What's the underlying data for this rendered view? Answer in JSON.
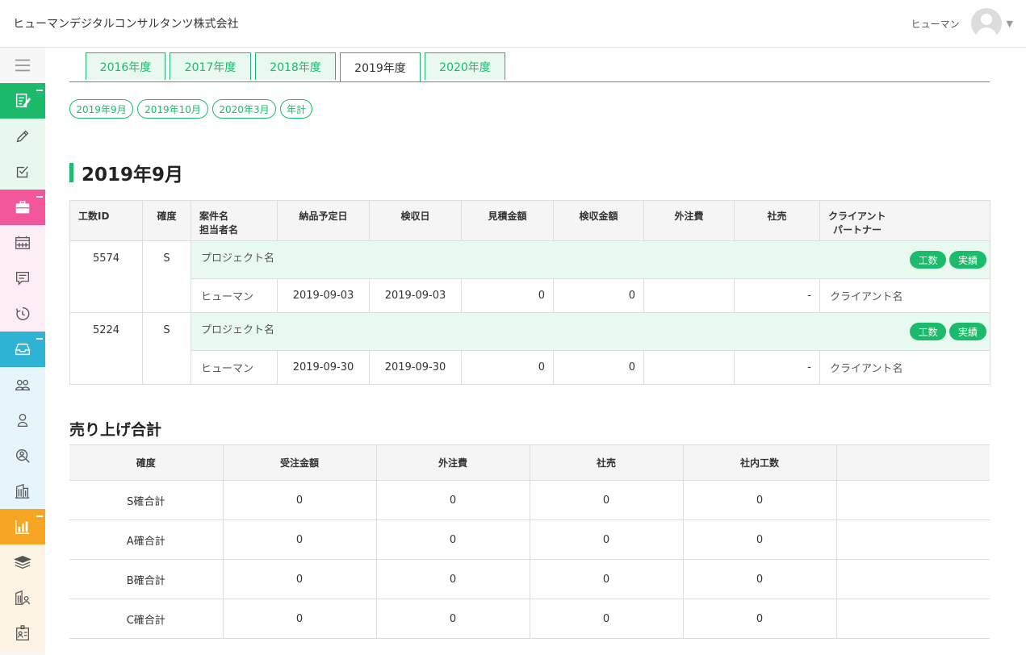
{
  "header": {
    "company": "ヒューマンデジタルコンサルタンツ株式会社",
    "user_name": "ヒューマン"
  },
  "sidebar": {
    "items": [
      {
        "icon": "hamburger-icon"
      },
      {
        "icon": "edit-note-icon"
      },
      {
        "icon": "pencil-icon"
      },
      {
        "icon": "checkbox-icon"
      },
      {
        "icon": "briefcase-icon"
      },
      {
        "icon": "calendar-icon"
      },
      {
        "icon": "chat-icon"
      },
      {
        "icon": "timer-icon"
      },
      {
        "icon": "inbox-icon"
      },
      {
        "icon": "group-icon"
      },
      {
        "icon": "person-icon"
      },
      {
        "icon": "user-search-icon"
      },
      {
        "icon": "building-icon"
      },
      {
        "icon": "bar-chart-icon"
      },
      {
        "icon": "layers-icon"
      },
      {
        "icon": "building-user-icon"
      },
      {
        "icon": "id-card-icon"
      }
    ]
  },
  "tabs": [
    "2016年度",
    "2017年度",
    "2018年度",
    "2019年度",
    "2020年度"
  ],
  "active_tab": "2019年度",
  "months": [
    "2019年9月",
    "2019年10月",
    "2020年3月",
    "年計"
  ],
  "section_title": "2019年9月",
  "table": {
    "headers": {
      "id": "工数ID",
      "certainty": "確度",
      "project_line1": "案件名",
      "project_line2": "担当者名",
      "delivery": "納品予定日",
      "inspection": "検収日",
      "estimate": "見積金額",
      "inspected_amount": "検収金額",
      "outsourcing": "外注費",
      "internal": "社売",
      "client_line1": "クライアント",
      "client_line2": "パートナー"
    },
    "rows": [
      {
        "id": "5574",
        "certainty": "S",
        "project": "プロジェクト名",
        "badge1": "工数",
        "badge2": "実績",
        "person": "ヒューマン",
        "delivery": "2019-09-03",
        "inspection": "2019-09-03",
        "estimate": "0",
        "inspected_amount": "0",
        "outsourcing": "",
        "internal": "-",
        "client": "クライアント名"
      },
      {
        "id": "5224",
        "certainty": "S",
        "project": "プロジェクト名",
        "badge1": "工数",
        "badge2": "実績",
        "person": "ヒューマン",
        "delivery": "2019-09-30",
        "inspection": "2019-09-30",
        "estimate": "0",
        "inspected_amount": "0",
        "outsourcing": "",
        "internal": "-",
        "client": "クライアント名"
      }
    ]
  },
  "summary": {
    "title": "売り上げ合計",
    "headers": [
      "確度",
      "受注金額",
      "外注費",
      "社売",
      "社内工数"
    ],
    "rows": [
      [
        "S確合計",
        "0",
        "0",
        "0",
        "0"
      ],
      [
        "A確合計",
        "0",
        "0",
        "0",
        "0"
      ],
      [
        "B確合計",
        "0",
        "0",
        "0",
        "0"
      ],
      [
        "C確合計",
        "0",
        "0",
        "0",
        "0"
      ]
    ]
  },
  "colors": {
    "green": "#1cbb6c",
    "pink": "#f3579b",
    "blue": "#2fb3d4",
    "orange": "#f6a623"
  }
}
